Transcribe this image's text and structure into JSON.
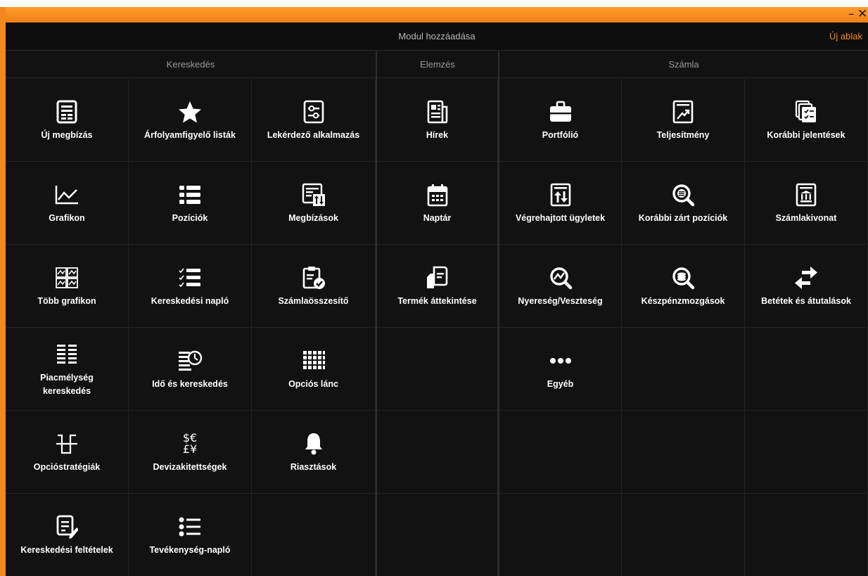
{
  "titlebar": {
    "minimize_glyph": "–",
    "close_glyph": "✕"
  },
  "header": {
    "title": "Modul hozzáadása",
    "new_window": "Új ablak"
  },
  "sections": {
    "trading": "Kereskedés",
    "analysis": "Elemzés",
    "account": "Számla"
  },
  "modules": {
    "uj_megbizas": "Új megbízás",
    "arfolyam": "Árfolyamfigyelő listák",
    "lekerdezo": "Lekérdező alkalmazás",
    "grafikon": "Grafikon",
    "poziciok": "Pozíciók",
    "megbizasok": "Megbízások",
    "tobb_grafikon": "Több grafikon",
    "ker_naplo": "Kereskedési napló",
    "szamlaossz": "Számlaösszesítő",
    "piacmelyseg": "Piacmélység kereskedés",
    "ido_ker": "Idő és kereskedés",
    "opcios_lanc": "Opciós lánc",
    "opciostrat": "Opcióstratégiák",
    "devizakit": "Devizakitettségek",
    "riasztasok": "Riasztások",
    "ker_feltetelek": "Kereskedési feltételek",
    "tev_naplo": "Tevékenység-napló",
    "hirek": "Hírek",
    "naptar": "Naptár",
    "termek": "Termék áttekintése",
    "portfolio": "Portfólió",
    "teljesitmeny": "Teljesítmény",
    "kor_jelentesek": "Korábbi jelentések",
    "vegrehajtott": "Végrehajtott ügyletek",
    "kor_zart": "Korábbi zárt pozíciók",
    "szamlakivonat": "Számlakivonat",
    "nyereseg": "Nyereség/Veszteség",
    "keszpenz": "Készpénzmozgások",
    "betetek": "Betétek és átutalások",
    "egyeb": "Egyéb"
  },
  "icons": {
    "currency_line1": "$€",
    "currency_line2": "£¥"
  },
  "colors": {
    "accent": "#f5871f",
    "background": "#121212",
    "text": "#ffffff"
  }
}
